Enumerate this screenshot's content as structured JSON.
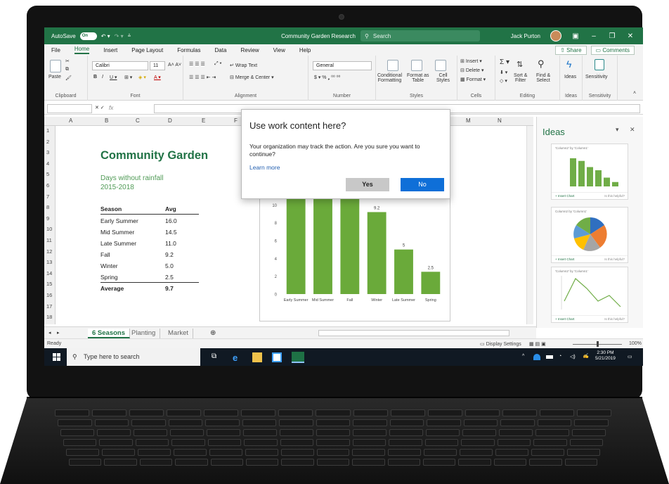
{
  "titlebar": {
    "autosave_label": "AutoSave",
    "autosave_state": "On",
    "document_title": "Community Garden Research",
    "search_placeholder": "Search",
    "user_name": "Jack Purton"
  },
  "ribbon_tabs": [
    "File",
    "Home",
    "Insert",
    "Page Layout",
    "Formulas",
    "Data",
    "Review",
    "View",
    "Help"
  ],
  "active_tab": "Home",
  "share_label": "Share",
  "comments_label": "Comments",
  "ribbon": {
    "paste": "Paste",
    "font_name": "Calibri",
    "font_size": "11",
    "wrap_text": "Wrap Text",
    "merge_center": "Merge & Center",
    "number_format": "General",
    "conditional_formatting": "Conditional\nFormatting",
    "format_as_table": "Format as\nTable",
    "cell_styles": "Cell\nStyles",
    "insert": "Insert",
    "delete": "Delete",
    "format": "Format",
    "sort_filter": "Sort &\nFilter",
    "find_select": "Find &\nSelect",
    "ideas": "Ideas",
    "sensitivity": "Sensitivity",
    "groups": [
      "Clipboard",
      "Font",
      "Alignment",
      "Number",
      "Styles",
      "Cells",
      "Editing",
      "Ideas",
      "Sensitivity"
    ]
  },
  "formula_bar": {
    "fx": "fx"
  },
  "columns": [
    "A",
    "B",
    "C",
    "D",
    "E",
    "F",
    "M",
    "N"
  ],
  "rows": [
    "1",
    "2",
    "3",
    "4",
    "5",
    "6",
    "7",
    "8",
    "9",
    "10",
    "11",
    "12",
    "13",
    "14",
    "15",
    "16",
    "17",
    "18"
  ],
  "sheet": {
    "title": "Community Garden",
    "subtitle_1": "Days without rainfall",
    "subtitle_2": "2015-2018",
    "header": {
      "season": "Season",
      "avg": "Avg"
    },
    "rows": [
      {
        "season": "Early Summer",
        "avg": "16.0"
      },
      {
        "season": "Mid Summer",
        "avg": "14.5"
      },
      {
        "season": "Late Summer",
        "avg": "11.0"
      },
      {
        "season": "Fall",
        "avg": "9.2"
      },
      {
        "season": "Winter",
        "avg": "5.0"
      },
      {
        "season": "Spring",
        "avg": "2.5"
      }
    ],
    "average": {
      "label": "Average",
      "value": "9.7"
    }
  },
  "chart_data": {
    "type": "bar",
    "categories": [
      "Early Summer",
      "Mid Summer",
      "Fall",
      "Winter",
      "Late Summer",
      "Spring"
    ],
    "values": [
      16.0,
      14.5,
      11,
      9.2,
      5,
      2.5
    ],
    "data_labels": [
      "",
      "",
      "11",
      "9.2",
      "5",
      "2.5"
    ],
    "ylim": [
      0,
      12
    ],
    "yticks": [
      "0",
      "2",
      "4",
      "6",
      "8",
      "10",
      "12"
    ],
    "bar_color": "#6aaa3a",
    "title": "",
    "xlabel": "",
    "ylabel": ""
  },
  "dialog": {
    "title": "Use work content here?",
    "body": "Your organization may track the action. Are you sure you want to continue?",
    "link": "Learn more",
    "yes": "Yes",
    "no": "No"
  },
  "ideas_pane": {
    "title": "Ideas",
    "cards": [
      {
        "caption": "'Column2' by 'Column1'",
        "kind": "bar"
      },
      {
        "caption": "Column2 by 'Column1'",
        "kind": "pie"
      },
      {
        "caption": "'Column2' by 'Column1'",
        "kind": "line"
      }
    ],
    "insert_label": "+ Insert Chart",
    "helpful_label": "Is this helpful?"
  },
  "sheet_tabs": [
    "6 Seasons",
    "Planting",
    "Market"
  ],
  "active_sheet": "6 Seasons",
  "status": {
    "ready": "Ready",
    "display_settings": "Display Settings",
    "zoom": "100%"
  },
  "taskbar": {
    "search_placeholder": "Type here to search",
    "time": "2:30 PM",
    "date": "5/21/2019"
  },
  "colors": {
    "excel_green": "#217346",
    "taskbar": "#101923",
    "dialog_primary": "#0f6fd8"
  }
}
